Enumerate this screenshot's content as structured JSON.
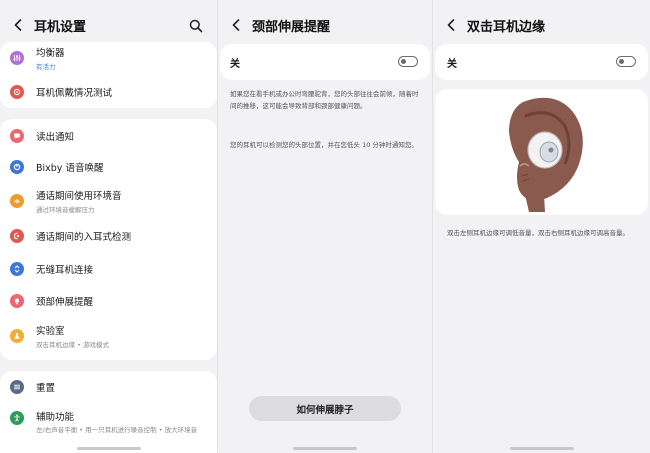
{
  "panel1": {
    "title": "耳机设置",
    "items": [
      {
        "label": "均衡器",
        "sub": "有活力"
      },
      {
        "label": "耳机佩戴情况测试"
      },
      {
        "label": "读出通知"
      },
      {
        "label": "Bixby 语音唤醒"
      },
      {
        "label": "通话期间使用环境音",
        "sub": "通过环境音缓解压力"
      },
      {
        "label": "通话期间的入耳式检测"
      },
      {
        "label": "无缝耳机连接"
      },
      {
        "label": "颈部伸展提醒"
      },
      {
        "label": "实验室",
        "sub": "双击耳机边缘 • 游戏模式"
      },
      {
        "label": "重置"
      },
      {
        "label": "辅助功能",
        "sub": "左/右声音平衡 • 用一只耳机进行噪音控制 • 放大环境音"
      }
    ]
  },
  "panel2": {
    "title": "颈部伸展提醒",
    "toggle_label": "关",
    "toggle_on": false,
    "paragraph1": "如果您在看手机或办公时弯腰驼背，您的头部往往会前倾，随着时间的推移，这可能会导致背部和颈部健康问题。",
    "paragraph2": "您的耳机可以检测您的头部位置，并在您低头 10 分钟时通知您。",
    "button_label": "如何伸展脖子"
  },
  "panel3": {
    "title": "双击耳机边缘",
    "toggle_label": "关",
    "toggle_on": false,
    "description": "双击左侧耳机边缘可调低音量，双击右侧耳机边缘可调高音量。"
  },
  "colors": {
    "background": "#f2f2f4",
    "card": "#ffffff",
    "icon_purple": "#b36fd9",
    "icon_red": "#e0584f",
    "icon_blue": "#3d76d9",
    "icon_orange": "#ef9a2f",
    "icon_pink": "#ef6570",
    "icon_yellow": "#f0ad3a",
    "icon_slate": "#5a6b86",
    "icon_green": "#2f9b5a",
    "accent_blue": "#3e7bdc"
  }
}
